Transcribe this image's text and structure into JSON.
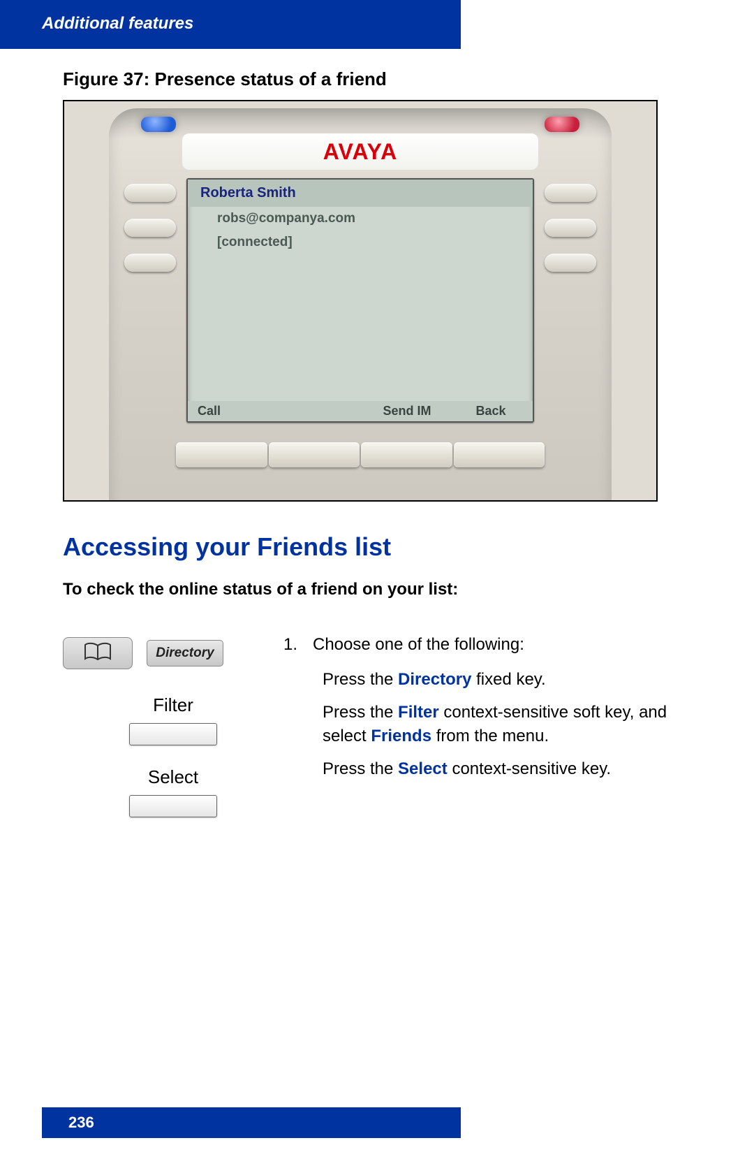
{
  "header": {
    "title": "Additional features"
  },
  "figure": {
    "caption": "Figure 37: Presence status of a friend",
    "logo": "AVAYA",
    "screen": {
      "name": "Roberta Smith",
      "email": "robs@companya.com",
      "status": "[connected]",
      "softkeys": {
        "k1": "Call",
        "k2": "",
        "k3": "Send IM",
        "k4": "Back"
      }
    }
  },
  "section": {
    "heading": "Accessing your Friends list",
    "subheading": "To check the online status of a friend on your list:"
  },
  "keys": {
    "directory": "Directory",
    "filter": "Filter",
    "select": "Select"
  },
  "steps": {
    "num": "1.",
    "intro": "Choose one of the following:",
    "a_prefix": "Press the ",
    "a_key": "Directory",
    "a_suffix": " fixed key.",
    "b_prefix": "Press the ",
    "b_key": "Filter",
    "b_mid": " context-sensitive soft key, and select ",
    "b_key2": "Friends",
    "b_suffix": " from the menu.",
    "c_prefix": "Press the ",
    "c_key": "Select",
    "c_suffix": " context-sensitive key."
  },
  "footer": {
    "page": "236"
  }
}
